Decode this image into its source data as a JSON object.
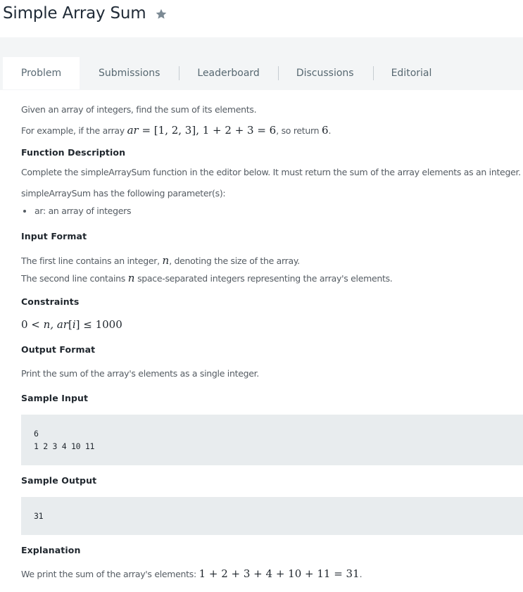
{
  "header": {
    "title": "Simple Array Sum"
  },
  "tabs": [
    {
      "label": "Problem"
    },
    {
      "label": "Submissions"
    },
    {
      "label": "Leaderboard"
    },
    {
      "label": "Discussions"
    },
    {
      "label": "Editorial"
    }
  ],
  "problem": {
    "intro": "Given an array of integers, find the sum of its elements.",
    "example": {
      "prefix": "For example, if the array",
      "var": "ar",
      "eq": " = [1, 2, 3], 1 + 2 + 3 = 6",
      "mid": ", so return",
      "ret": "6",
      "end": "."
    },
    "function_description": {
      "heading": "Function Description",
      "text": "Complete the simpleArraySum function in the editor below. It must return the sum of the array elements as an integer.",
      "params_intro": "simpleArraySum has the following parameter(s):",
      "params": [
        "ar: an array of integers"
      ]
    },
    "input_format": {
      "heading": "Input Format",
      "line1_pre": "The first line contains an integer,",
      "line1_var": "n",
      "line1_post": ", denoting the size of the array.",
      "line2_pre": "The second line contains",
      "line2_var": "n",
      "line2_post": " space-separated integers representing the array's elements."
    },
    "constraints": {
      "heading": "Constraints",
      "pre": "0 < ",
      "vars": "n, ar",
      "bracket_open": "[",
      "index": "i",
      "post": "] ≤ 1000"
    },
    "output_format": {
      "heading": "Output Format",
      "text": "Print the sum of the array's elements as a single integer."
    },
    "sample_input": {
      "heading": "Sample Input",
      "lines": [
        "6",
        "1 2 3 4 10 11"
      ]
    },
    "sample_output": {
      "heading": "Sample Output",
      "lines": [
        "31"
      ]
    },
    "explanation": {
      "heading": "Explanation",
      "text": "We print the sum of the array's elements:",
      "math": "1 + 2 + 3 + 4 + 10 + 11 = 31",
      "end": "."
    }
  },
  "colors": {
    "text": "#555c63",
    "heading": "#1f262d",
    "tab_band": "#f3f5f6",
    "code_bg": "#e8ecee",
    "star": "#7c8a94"
  }
}
